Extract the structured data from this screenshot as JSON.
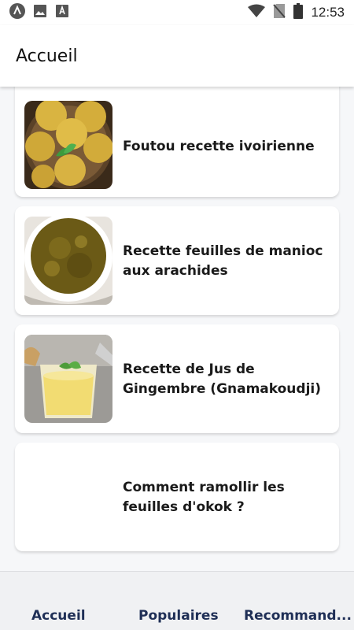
{
  "status_bar": {
    "time": "12:53",
    "left_icons": [
      "app-icon",
      "image-icon",
      "notification-icon"
    ],
    "right_icons": [
      "wifi-icon",
      "no-sim-icon",
      "battery-icon"
    ]
  },
  "app_bar": {
    "title": "Accueil"
  },
  "recipes": [
    {
      "title": "Foutou recette ivoirienne",
      "image": "foutou-balls"
    },
    {
      "title": "Recette feuilles de manioc aux arachides",
      "image": "cassava-leaf-sauce"
    },
    {
      "title": "Recette de Jus de Gingembre (Gnamakoudji)",
      "image": "ginger-juice-glass"
    },
    {
      "title": "Comment ramollir les feuilles d'okok ?",
      "image": ""
    }
  ],
  "bottom_nav": {
    "items": [
      "Accueil",
      "Populaires",
      "Recommand..."
    ]
  },
  "colors": {
    "nav_text": "#1f2f56",
    "page_background": "#f6f7f9",
    "card_background": "#ffffff"
  }
}
